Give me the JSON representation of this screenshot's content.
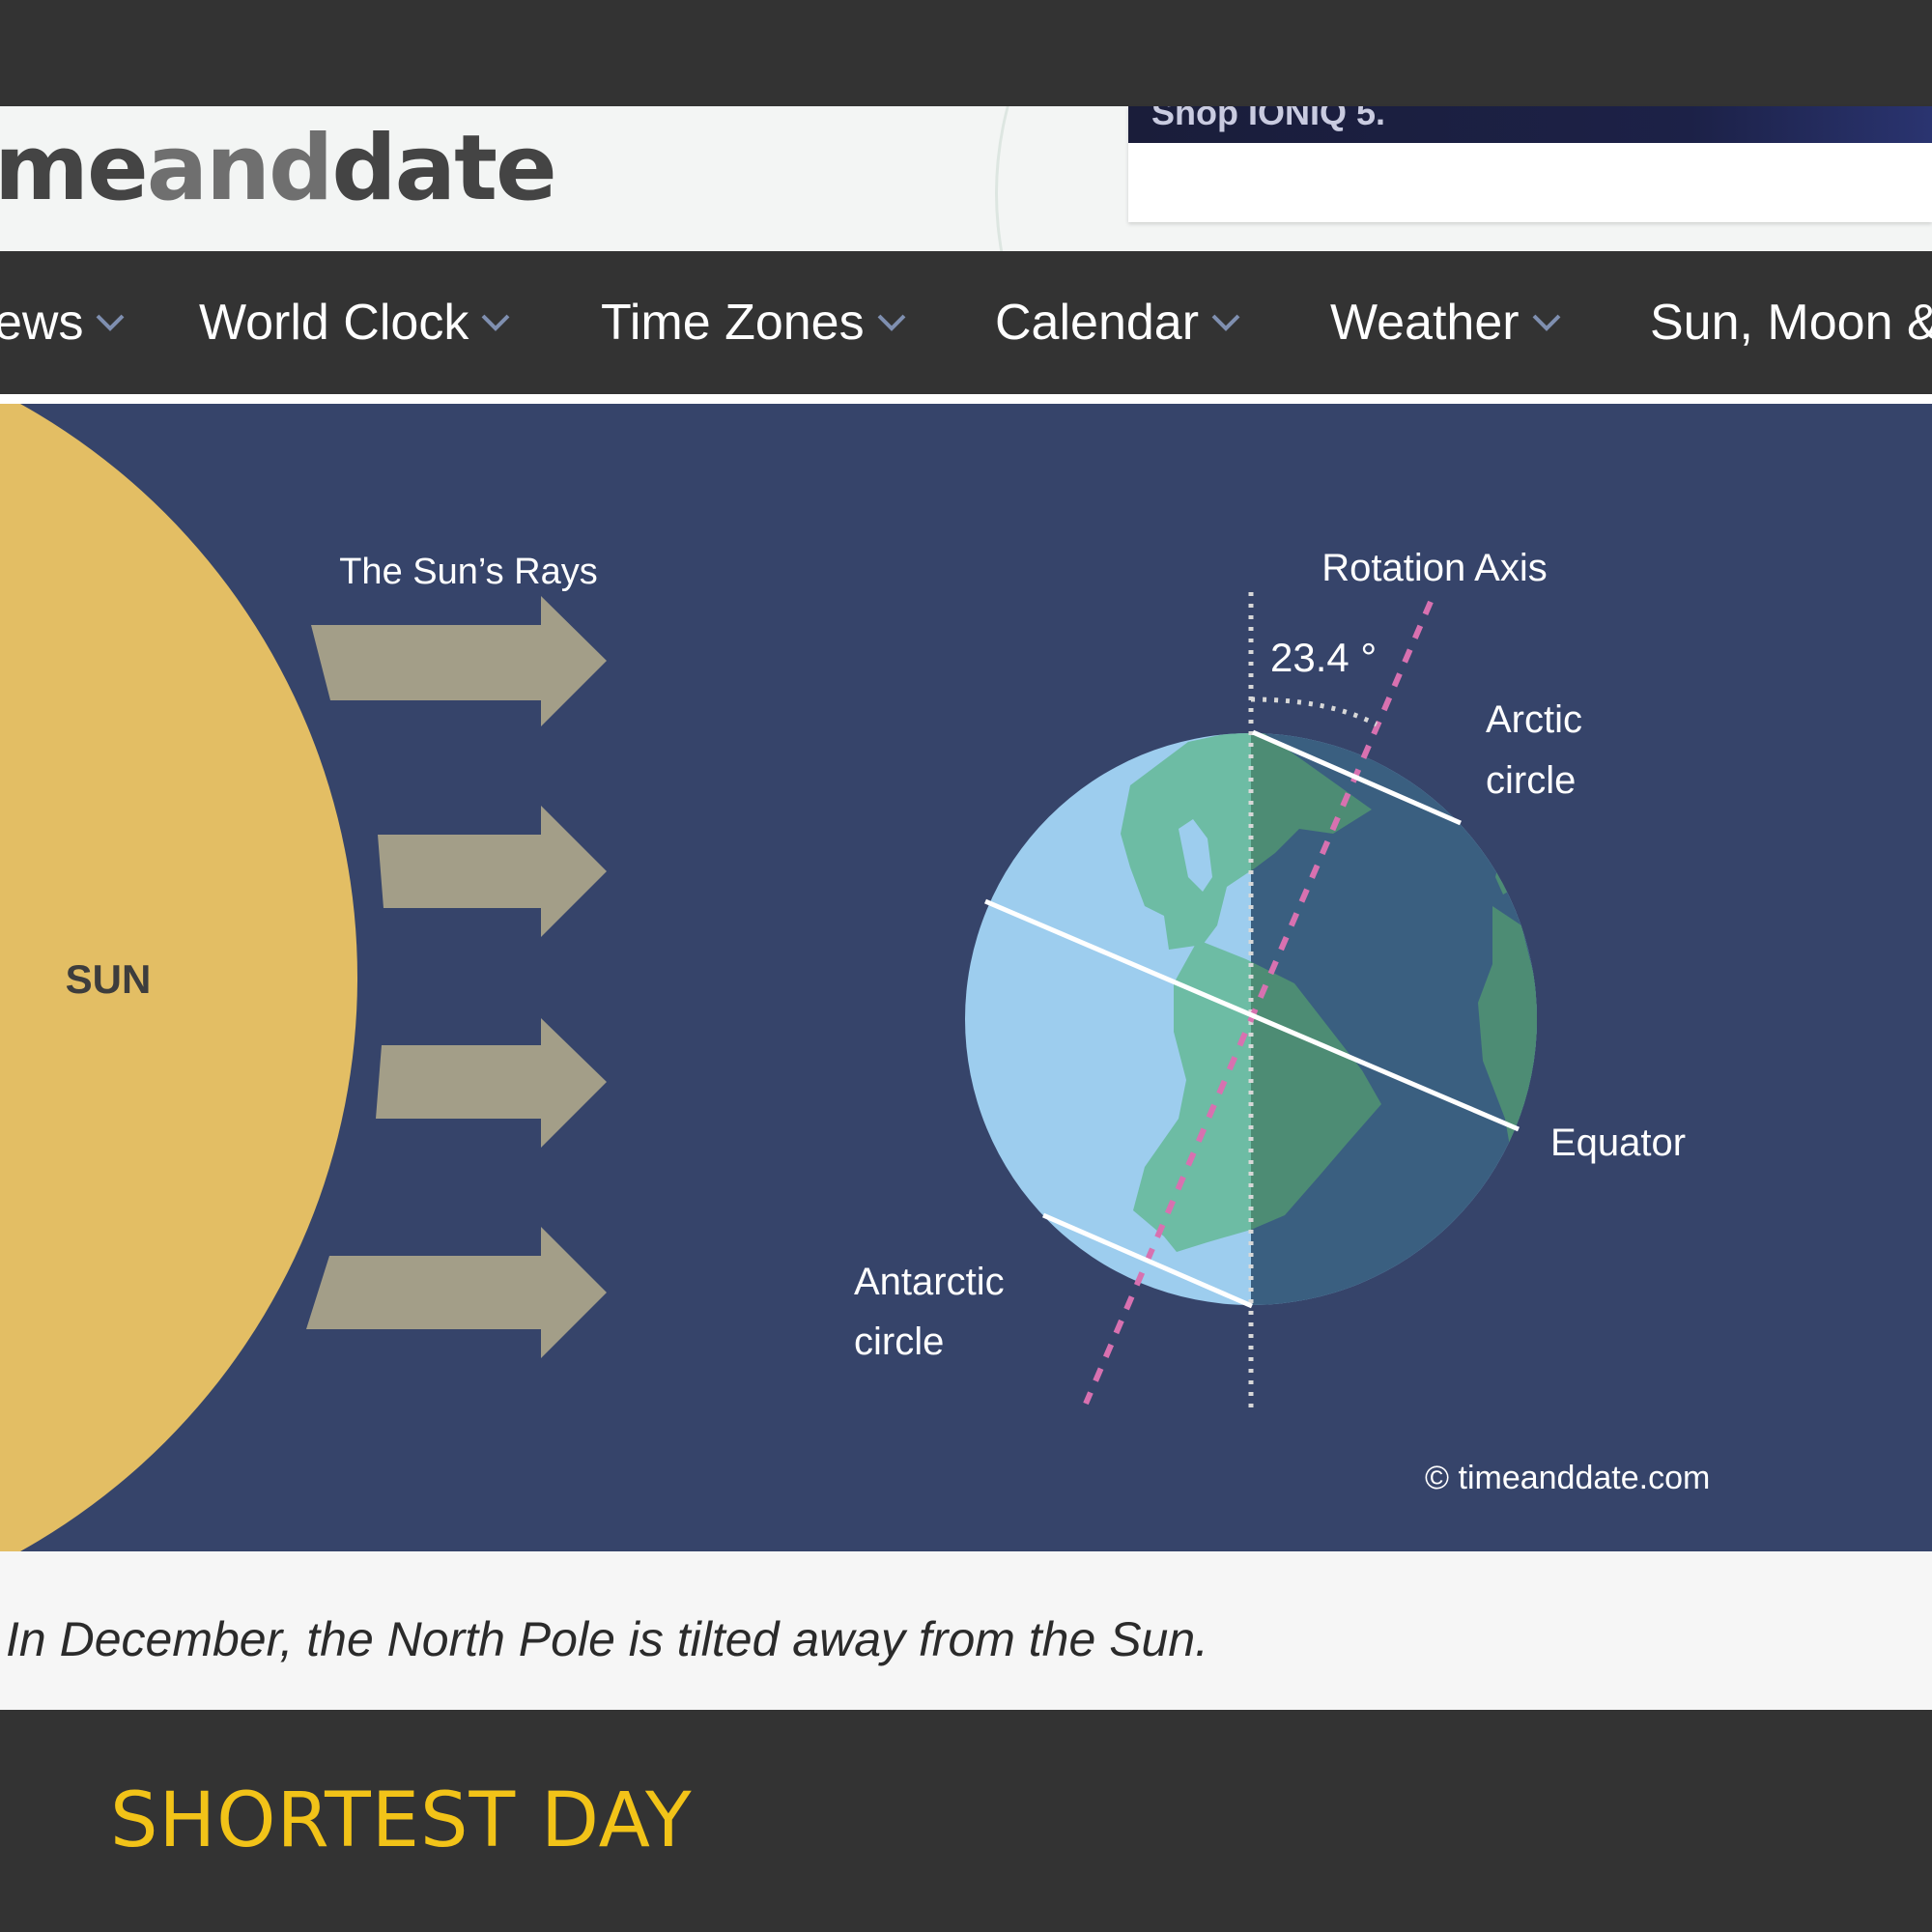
{
  "header": {
    "logo_part1": "me",
    "logo_part2": "and",
    "logo_part3": "date",
    "ad_text": "Shop IONIQ 5."
  },
  "nav": {
    "items": [
      {
        "label": "ews"
      },
      {
        "label": "World Clock"
      },
      {
        "label": "Time Zones"
      },
      {
        "label": "Calendar"
      },
      {
        "label": "Weather"
      },
      {
        "label": "Sun, Moon &"
      }
    ],
    "chevron_icon": "chevron-down-icon"
  },
  "figure": {
    "sun_label": "SUN",
    "rays_label": "The Sun’s Rays",
    "axis_label": "Rotation Axis",
    "tilt_label": "23.4 °",
    "arctic_line1": "Arctic",
    "arctic_line2": "circle",
    "equator_label": "Equator",
    "antarctic_line1": "Antarctic",
    "antarctic_line2": "circle",
    "copyright": "© timeanddate.com",
    "colors": {
      "background": "#36446a",
      "sun": "#e3be64",
      "arrows": "#a39e88",
      "ocean_day": "#9dcdee",
      "land_day": "#6dbca4",
      "ocean_night": "#3a5f80",
      "land_night": "#4d8c74",
      "axis_tilted": "#d871b0"
    }
  },
  "caption": "In December, the North Pole is tilted away from the Sun.",
  "section_title": "SHORTEST DAY"
}
